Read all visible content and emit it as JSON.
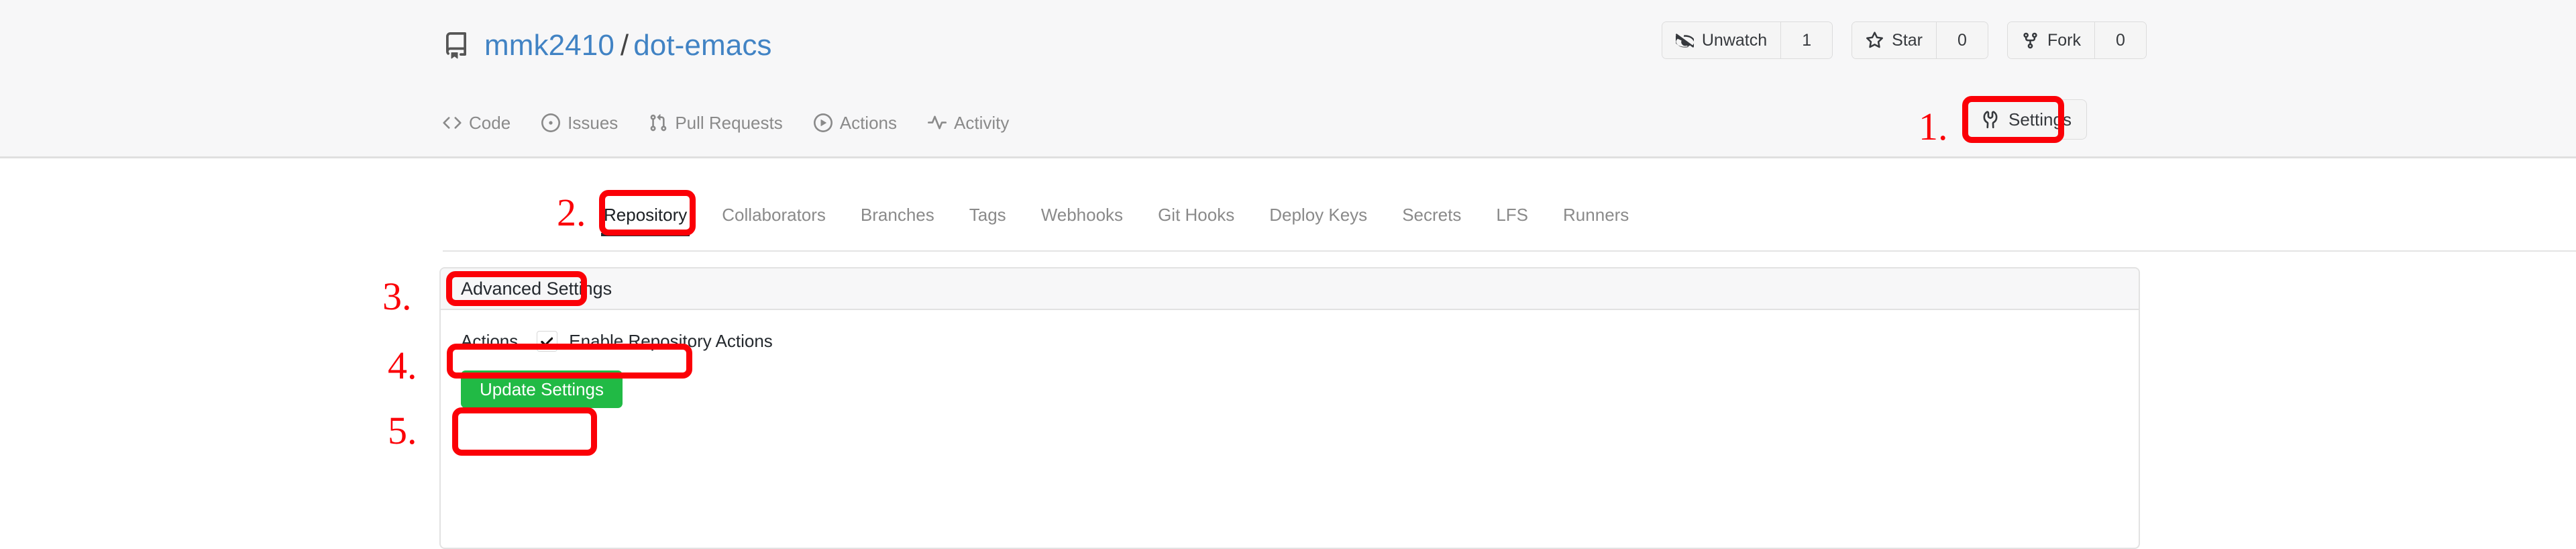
{
  "repo": {
    "icon": "repo-icon",
    "owner": "mmk2410",
    "separator": "/",
    "name": "dot-emacs"
  },
  "repo_actions": [
    {
      "icon": "eye-closed-icon",
      "label": "Unwatch",
      "count": "1"
    },
    {
      "icon": "star-icon",
      "label": "Star",
      "count": "0"
    },
    {
      "icon": "fork-icon",
      "label": "Fork",
      "count": "0"
    }
  ],
  "nav": {
    "items": [
      {
        "icon": "code-icon",
        "label": "Code"
      },
      {
        "icon": "issue-opened-icon",
        "label": "Issues"
      },
      {
        "icon": "git-pull-request-icon",
        "label": "Pull Requests"
      },
      {
        "icon": "play-circle-icon",
        "label": "Actions"
      },
      {
        "icon": "pulse-icon",
        "label": "Activity"
      }
    ],
    "settings": {
      "icon": "tools-icon",
      "label": "Settings"
    }
  },
  "settings_tabs": [
    {
      "label": "Repository",
      "active": true
    },
    {
      "label": "Collaborators",
      "active": false
    },
    {
      "label": "Branches",
      "active": false
    },
    {
      "label": "Tags",
      "active": false
    },
    {
      "label": "Webhooks",
      "active": false
    },
    {
      "label": "Git Hooks",
      "active": false
    },
    {
      "label": "Deploy Keys",
      "active": false
    },
    {
      "label": "Secrets",
      "active": false
    },
    {
      "label": "LFS",
      "active": false
    },
    {
      "label": "Runners",
      "active": false
    }
  ],
  "panel": {
    "header_title": "Advanced Settings",
    "actions_row": {
      "label": "Actions",
      "checkbox_checked": true,
      "checkbox_label": "Enable Repository Actions"
    },
    "submit_label": "Update Settings"
  },
  "annotations": [
    {
      "number": "1.",
      "target": "settings-button"
    },
    {
      "number": "2.",
      "target": "repository-tab"
    },
    {
      "number": "3.",
      "target": "advanced-settings-header"
    },
    {
      "number": "4.",
      "target": "enable-repository-actions-checkbox"
    },
    {
      "number": "5.",
      "target": "update-settings-button"
    }
  ],
  "colors": {
    "annotation_red": "#fb0007",
    "link_blue": "#4183c4",
    "submit_green": "#21ba45",
    "header_bg": "#f7f7f8",
    "border": "#e2e2e2"
  }
}
